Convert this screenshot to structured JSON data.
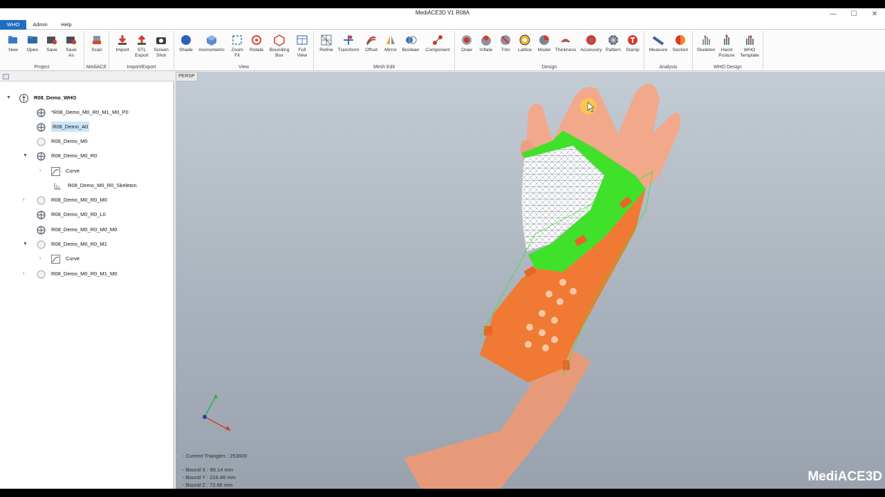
{
  "window": {
    "title": "MediACE3D V1 R08A",
    "minimize": "—",
    "maximize": "☐",
    "close": "✕"
  },
  "menu": {
    "tabs": [
      {
        "label": "WHO"
      },
      {
        "label": "Admin"
      },
      {
        "label": "Help"
      }
    ]
  },
  "ribbon": {
    "groups": {
      "project": "Project",
      "mediace": "MediACE",
      "import_export": "Import/Export",
      "view": "View",
      "mesh_edit": "Mesh Edit",
      "design": "Design",
      "analysis": "Analysis",
      "who_design": "WHO Design"
    },
    "buttons": {
      "new": "New",
      "open": "Open",
      "save": "Save",
      "save_as": "Save\nAs",
      "scan": "Scan",
      "import": "Import",
      "stl_export": "STL\nExport",
      "screen_shot": "Screen\nShot",
      "shade": "Shade",
      "axonometric": "Axonometric",
      "zoom_fit": "Zoom\nFit",
      "rotate": "Rotate",
      "bounding_box": "Bounding\nBox",
      "full_view": "Full\nView",
      "refine": "Refine",
      "transform": "Transform",
      "offset": "Offset",
      "mirror": "Mirror",
      "boolean": "Boolean",
      "component": "Component",
      "draw": "Draw",
      "inflate": "Inflate",
      "trim": "Trim",
      "lattice": "Lattice",
      "model": "Model",
      "thickness": "Thickness",
      "accessory": "Accessory",
      "pattern": "Pattern",
      "stamp": "Stamp",
      "measure": "Measure",
      "section": "Section",
      "skeleton": "Skeleton",
      "hand_posture": "Hand\nPosture",
      "who_template": "WHO\nTemplate"
    }
  },
  "tree": {
    "root": "R08_Demo_WHO",
    "items": [
      {
        "label": "*R08_Demo_M0_R0_M1_M0_P0"
      },
      {
        "label": "R08_Demo_A0"
      },
      {
        "label": "R08_Demo_M0"
      },
      {
        "label": "R08_Demo_M0_R0"
      },
      {
        "label": "Curve"
      },
      {
        "label": "R08_Demo_M0_R0_Skeleton"
      },
      {
        "label": "R08_Demo_M0_R0_M0"
      },
      {
        "label": "R08_Demo_M0_R0_L0"
      },
      {
        "label": "R08_Demo_M0_R0_M0_M0"
      },
      {
        "label": "R08_Demo_M0_R0_M1"
      },
      {
        "label": "Curve"
      },
      {
        "label": "R08_Demo_M0_R0_M1_M0"
      }
    ]
  },
  "viewport": {
    "tab": "PERSP",
    "triangles": "- Current Triangles : 253600",
    "bound_x": "- Bound X : 90.14 mm",
    "bound_y": "- Bound Y : 216.46 mm",
    "bound_z": "- Bound Z : 72.66 mm",
    "logo": "MediACE3D"
  },
  "colors": {
    "accent": "#1f6dc2",
    "skin": "#eea07f",
    "splint_orange": "#f07a33",
    "splint_green": "#3fe12a",
    "selection": "#cce4f7"
  }
}
